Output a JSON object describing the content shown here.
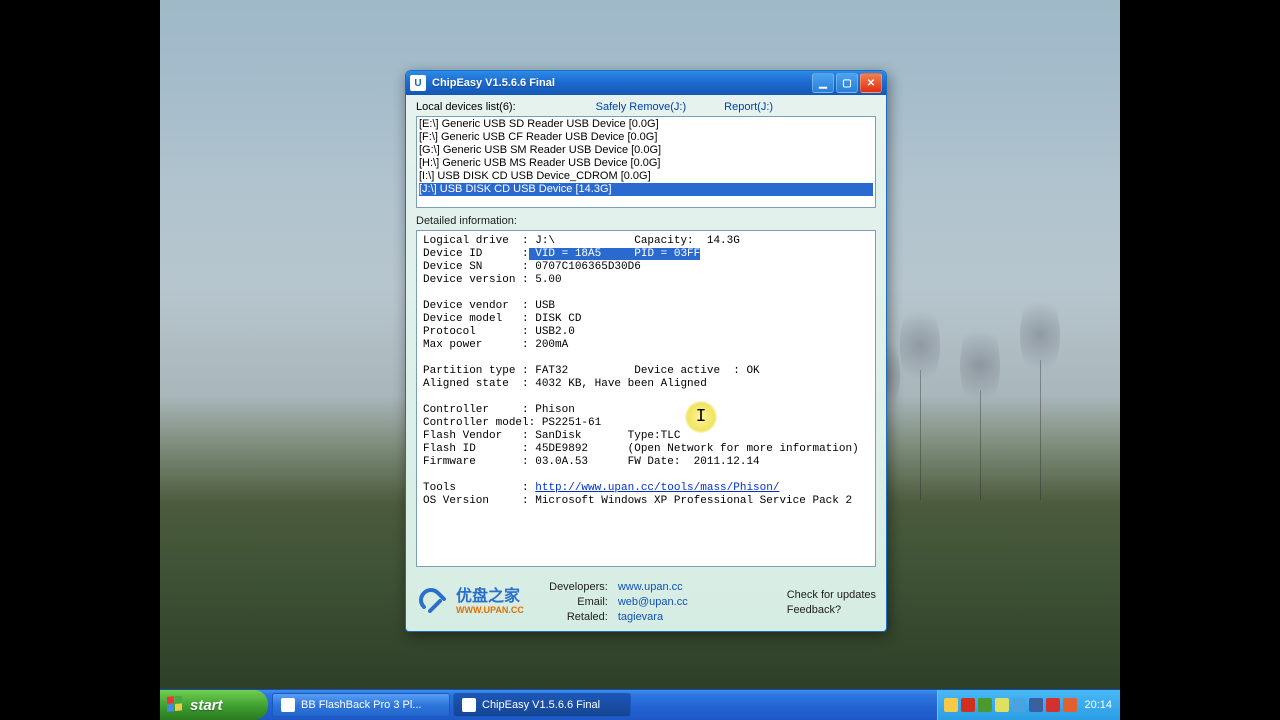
{
  "window": {
    "title": "ChipEasy V1.5.6.6 Final",
    "labels": {
      "local_list": "Local devices list(6):",
      "safely_remove": "Safely Remove(J:)",
      "report": "Report(J:)",
      "detailed_info": "Detailed information:"
    },
    "devices": [
      "[E:\\] Generic USB SD Reader USB Device [0.0G]",
      "[F:\\] Generic USB CF Reader USB Device [0.0G]",
      "[G:\\] Generic USB SM Reader USB Device [0.0G]",
      "[H:\\] Generic USB MS Reader USB Device [0.0G]",
      "[I:\\] USB DISK CD USB Device_CDROM [0.0G]",
      "[J:\\] USB DISK CD USB Device [14.3G]"
    ],
    "selected_index": 5,
    "detail": {
      "logical_drive": "J:\\",
      "capacity": "14.3G",
      "device_id_hl": " VID = 18A5     PID = 03FF",
      "device_sn": "0707C106365D30D6",
      "device_version": "5.00",
      "device_vendor": "USB",
      "device_model": "DISK CD",
      "protocol": "USB2.0",
      "max_power": "200mA",
      "partition_type": "FAT32",
      "device_active": "OK",
      "aligned_state": "4032 KB, Have been Aligned",
      "controller": "Phison",
      "controller_model": "PS2251-61",
      "flash_vendor": "SanDisk",
      "flash_type": "Type:TLC",
      "flash_id": "45DE9892",
      "flash_note": "(Open Network for more information)",
      "firmware": "03.0A.53",
      "fw_date": "2011.12.14",
      "tools_url": "http://www.upan.cc/tools/mass/Phison/",
      "os_version": "Microsoft Windows XP Professional Service Pack 2"
    },
    "footer": {
      "brand_cn": "优盘之家",
      "brand_sub": "WWW.UPAN.CC",
      "developers_k": "Developers:",
      "developers_v": "www.upan.cc",
      "email_k": "Email:",
      "email_v": "web@upan.cc",
      "retaled_k": "Retaled:",
      "retaled_v": "tagievara",
      "check_updates": "Check for updates",
      "feedback": "Feedback?"
    }
  },
  "taskbar": {
    "start": "start",
    "items": [
      {
        "label": "BB FlashBack Pro 3 Pl..."
      },
      {
        "label": "ChipEasy V1.5.6.6 Final"
      }
    ],
    "active_index": 1,
    "tray_colors": [
      "#f6c94a",
      "#d03020",
      "#4a9a30",
      "#e0e060",
      "#4aa3e0",
      "#3a60a0",
      "#d53030",
      "#e06030"
    ],
    "clock": "20:14"
  }
}
